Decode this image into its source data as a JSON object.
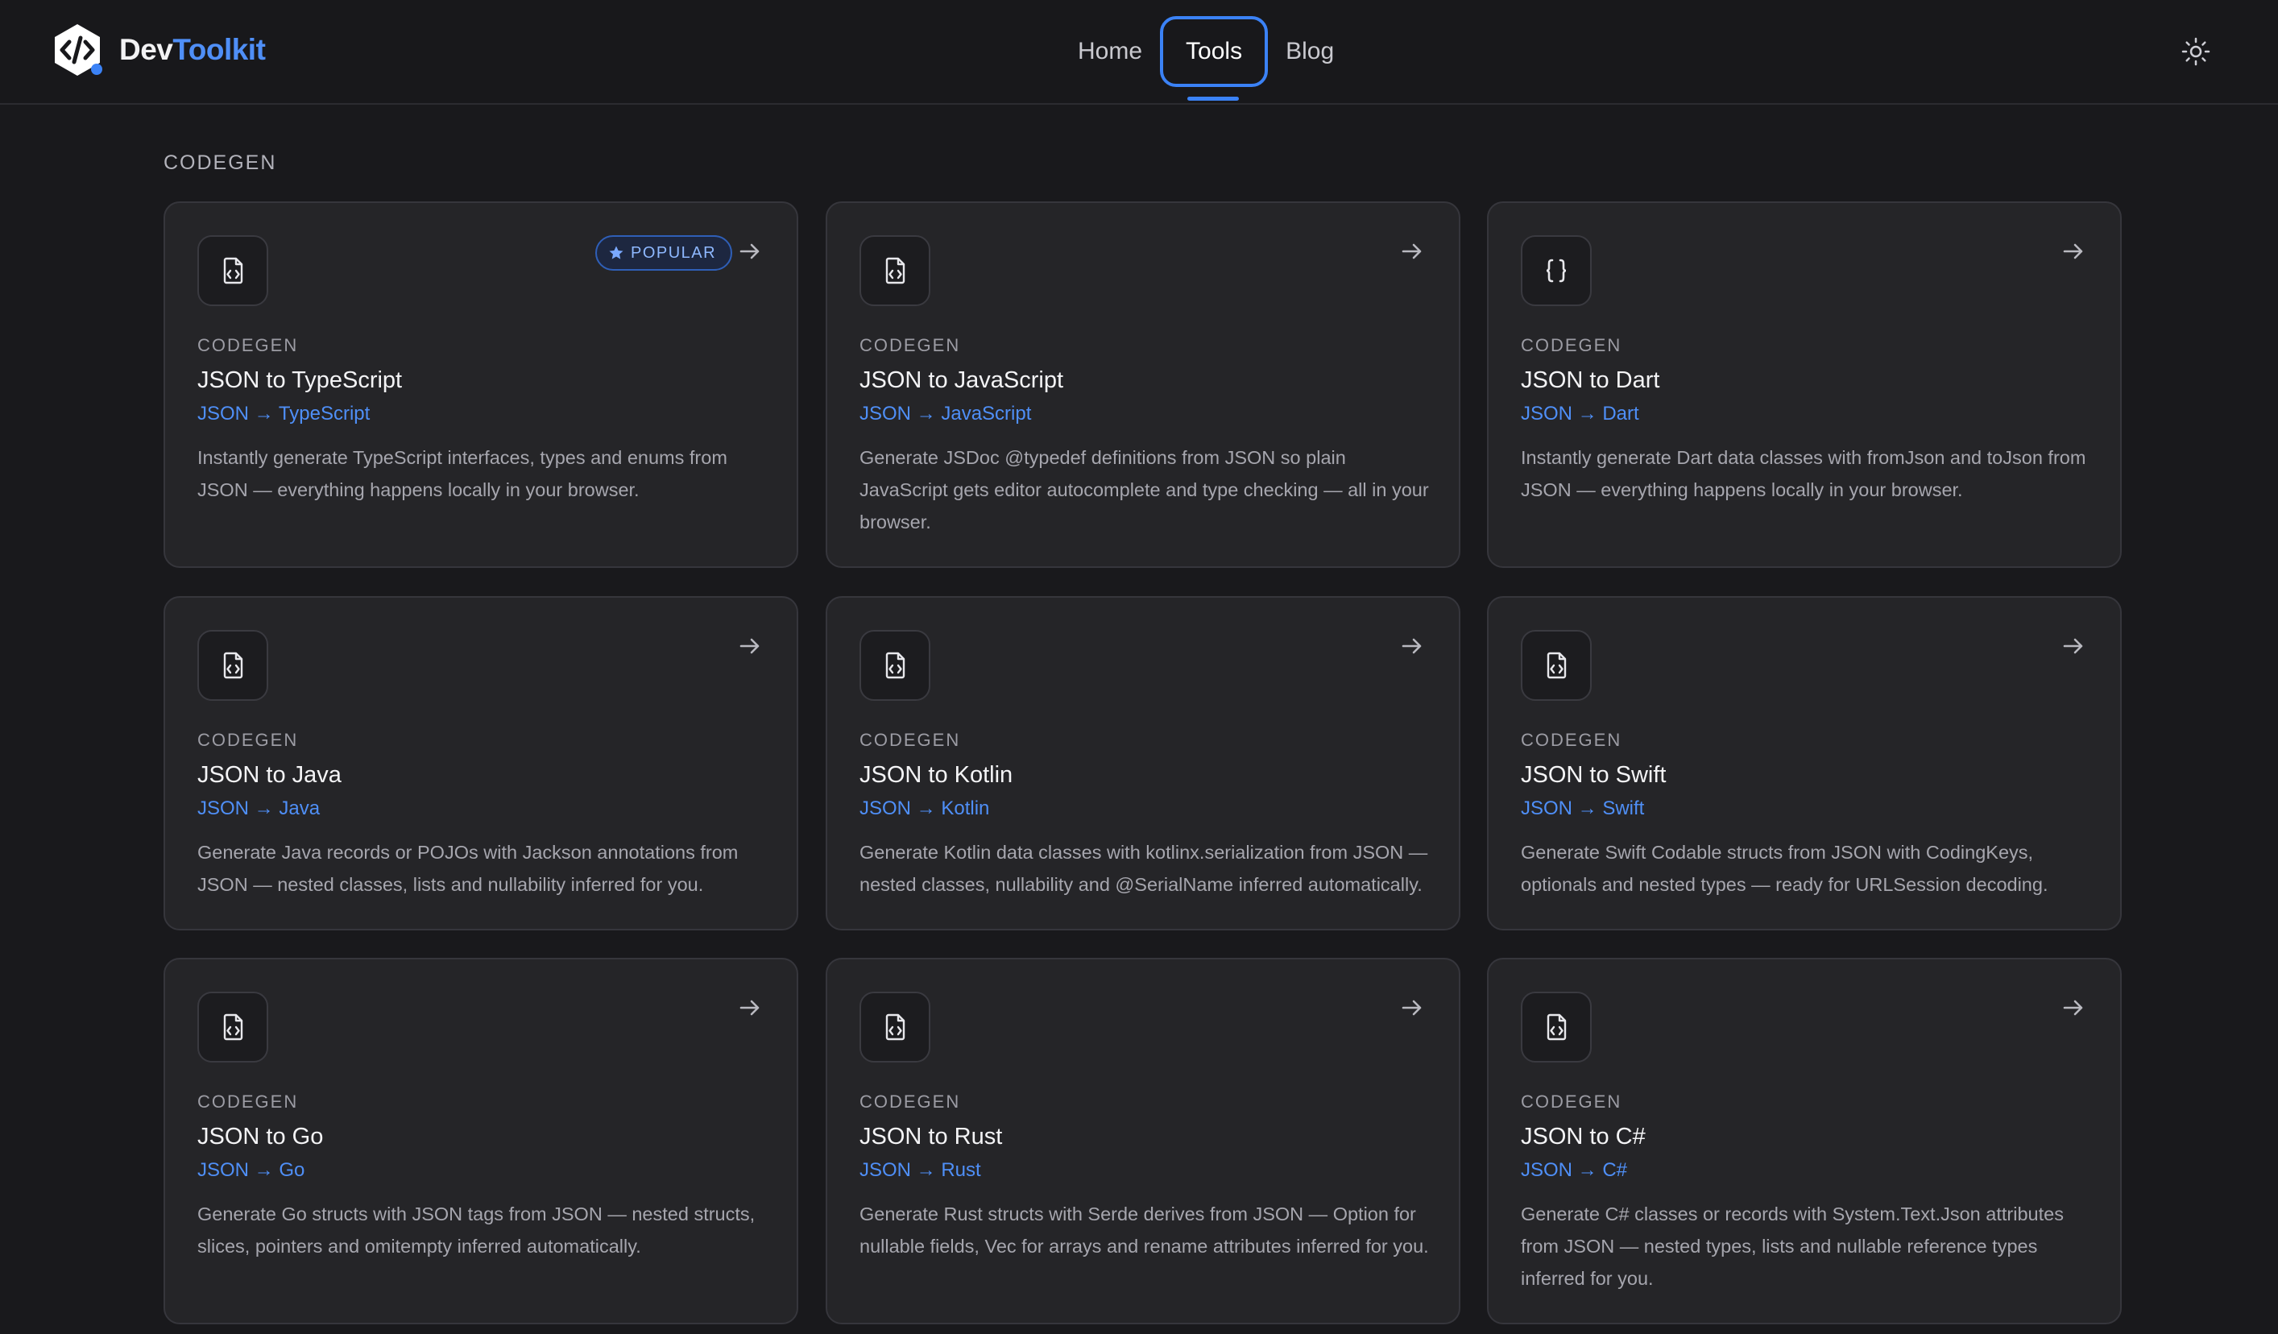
{
  "header": {
    "logo_text_main": "Dev",
    "logo_text_accent": "Toolkit",
    "nav": [
      {
        "label": "Home"
      },
      {
        "label": "Tools"
      },
      {
        "label": "Blog"
      }
    ],
    "active_nav": "Tools",
    "theme_icon": "sun-icon"
  },
  "section": {
    "label": "CODEGEN"
  },
  "colors": {
    "accent": "#3b82f6",
    "background": "#19191c",
    "card": "#252528"
  },
  "cards": [
    {
      "category": "CODEGEN",
      "title": "JSON to TypeScript",
      "subtitle": "JSON → TypeScript",
      "description": "Instantly generate TypeScript interfaces, types and enums from JSON — everything happens locally in your browser.",
      "icon": "file-code-icon",
      "badge": "POPULAR"
    },
    {
      "category": "CODEGEN",
      "title": "JSON to JavaScript",
      "subtitle": "JSON → JavaScript",
      "description": "Generate JSDoc @typedef definitions from JSON so plain JavaScript gets editor autocomplete and type checking — all in your browser.",
      "icon": "file-code-icon"
    },
    {
      "category": "CODEGEN",
      "title": "JSON to Dart",
      "subtitle": "JSON → Dart",
      "description": "Instantly generate Dart data classes with fromJson and toJson from JSON — everything happens locally in your browser.",
      "icon": "braces-icon"
    },
    {
      "category": "CODEGEN",
      "title": "JSON to Java",
      "subtitle": "JSON → Java",
      "description": "Generate Java records or POJOs with Jackson annotations from JSON — nested classes, lists and nullability inferred for you.",
      "icon": "file-code-icon"
    },
    {
      "category": "CODEGEN",
      "title": "JSON to Kotlin",
      "subtitle": "JSON → Kotlin",
      "description": "Generate Kotlin data classes with kotlinx.serialization from JSON — nested classes, nullability and @SerialName inferred automatically.",
      "icon": "file-code-icon"
    },
    {
      "category": "CODEGEN",
      "title": "JSON to Swift",
      "subtitle": "JSON → Swift",
      "description": "Generate Swift Codable structs from JSON with CodingKeys, optionals and nested types — ready for URLSession decoding.",
      "icon": "file-code-icon"
    },
    {
      "category": "CODEGEN",
      "title": "JSON to Go",
      "subtitle": "JSON → Go",
      "description": "Generate Go structs with JSON tags from JSON — nested structs, slices, pointers and omitempty inferred automatically.",
      "icon": "file-code-icon"
    },
    {
      "category": "CODEGEN",
      "title": "JSON to Rust",
      "subtitle": "JSON → Rust",
      "description": "Generate Rust structs with Serde derives from JSON — Option for nullable fields, Vec for arrays and rename attributes inferred for you.",
      "icon": "file-code-icon"
    },
    {
      "category": "CODEGEN",
      "title": "JSON to C#",
      "subtitle": "JSON → C#",
      "description": "Generate C# classes or records with System.Text.Json attributes from JSON — nested types, lists and nullable reference types inferred for you.",
      "icon": "file-code-icon"
    }
  ]
}
